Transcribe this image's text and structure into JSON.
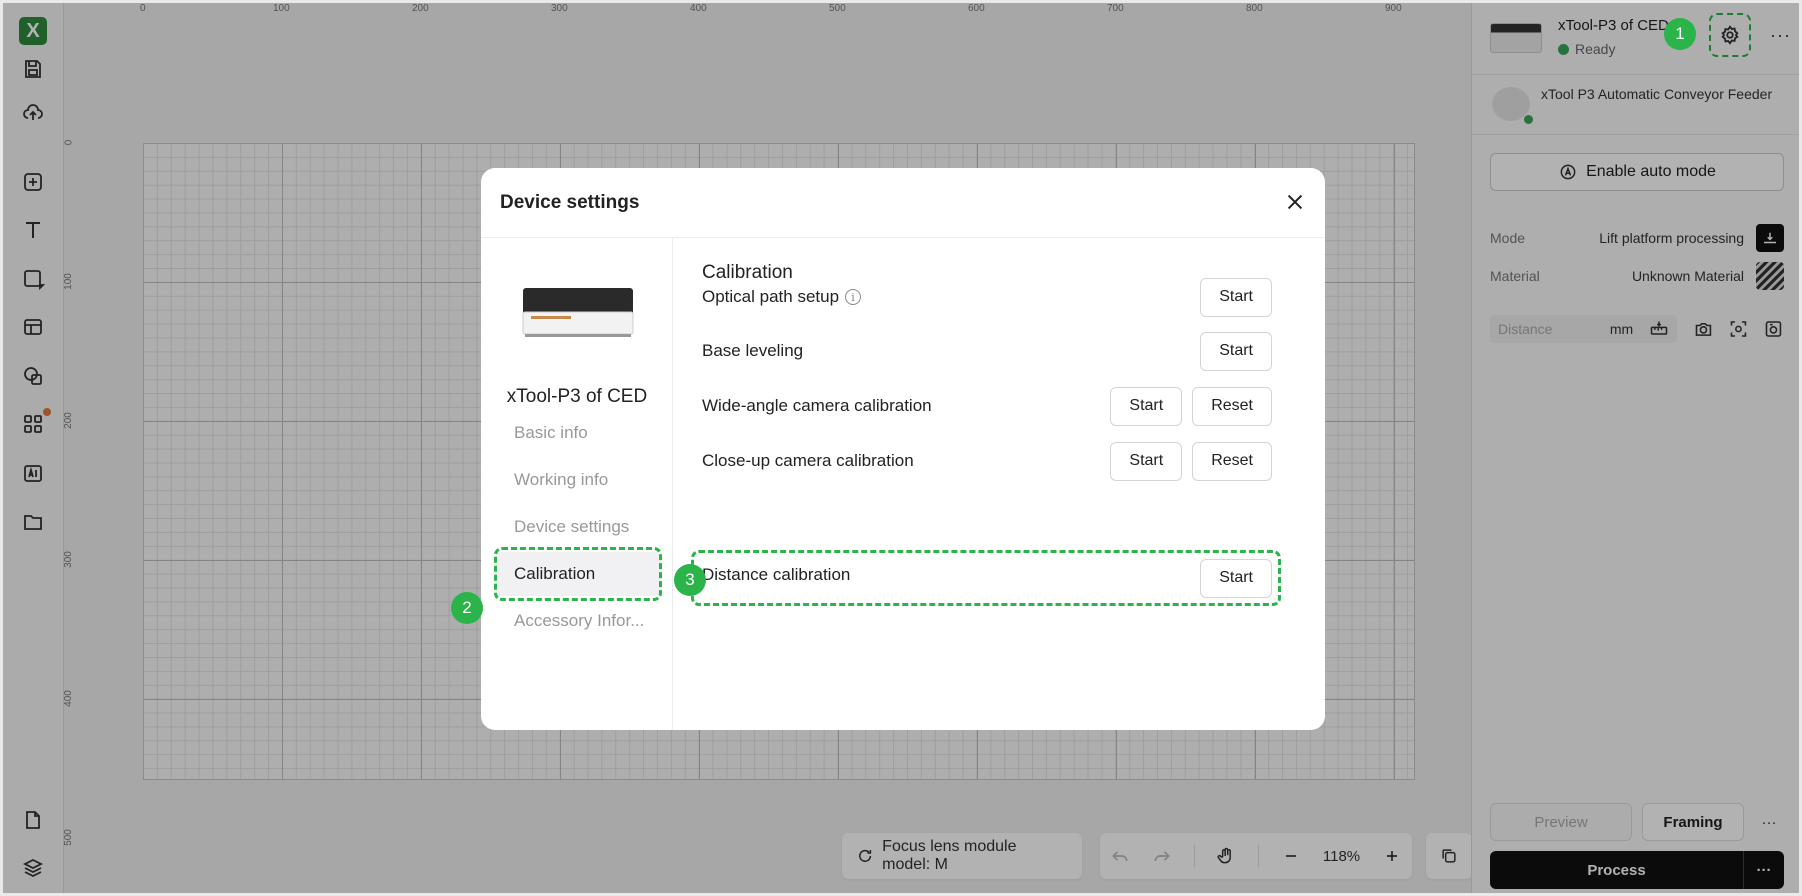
{
  "left_toolbar": {
    "logo": "X",
    "tools": [
      "logo-icon",
      "save-icon",
      "upload-cloud-icon",
      "add-icon",
      "text-icon",
      "shape-icon",
      "layout-icon",
      "copy-shape-icon",
      "apps-icon",
      "ai-icon",
      "folder-icon",
      "file-icon",
      "layers-icon"
    ]
  },
  "ruler": {
    "top": [
      "0",
      "100",
      "200",
      "300",
      "400",
      "500",
      "600",
      "700",
      "800",
      "900"
    ],
    "left": [
      "0",
      "100",
      "200",
      "300",
      "400",
      "500"
    ]
  },
  "canvas_bottom": {
    "focus_label": "Focus lens module model: M",
    "zoom": "118%"
  },
  "right_panel": {
    "device_name": "xTool-P3 of CED",
    "device_status": "Ready",
    "accessory_name": "xTool P3 Automatic Conveyor Feeder",
    "auto_mode_label": "Enable auto mode",
    "mode_key": "Mode",
    "mode_value": "Lift platform processing",
    "material_key": "Material",
    "material_value": "Unknown Material",
    "distance_placeholder": "Distance",
    "distance_unit": "mm",
    "preview_label": "Preview",
    "framing_label": "Framing",
    "process_label": "Process",
    "more": "···"
  },
  "modal": {
    "title": "Device settings",
    "device_name": "xTool-P3 of CED",
    "side_items": [
      "Basic info",
      "Working info",
      "Device settings",
      "Calibration",
      "Accessory Infor..."
    ],
    "section_title": "Calibration",
    "rows": [
      {
        "label": "Optical path setup",
        "start": "Start"
      },
      {
        "label": "Base leveling",
        "start": "Start"
      },
      {
        "label": "Wide-angle camera calibration",
        "start": "Start",
        "reset": "Reset"
      },
      {
        "label": "Close-up camera calibration",
        "start": "Start",
        "reset": "Reset"
      },
      {
        "label": "Distance calibration",
        "start": "Start"
      }
    ]
  },
  "badges": [
    "1",
    "2",
    "3"
  ],
  "colors": {
    "highlight": "#2ab44a",
    "status_green": "#3aa45b",
    "process_bg": "#111111"
  }
}
